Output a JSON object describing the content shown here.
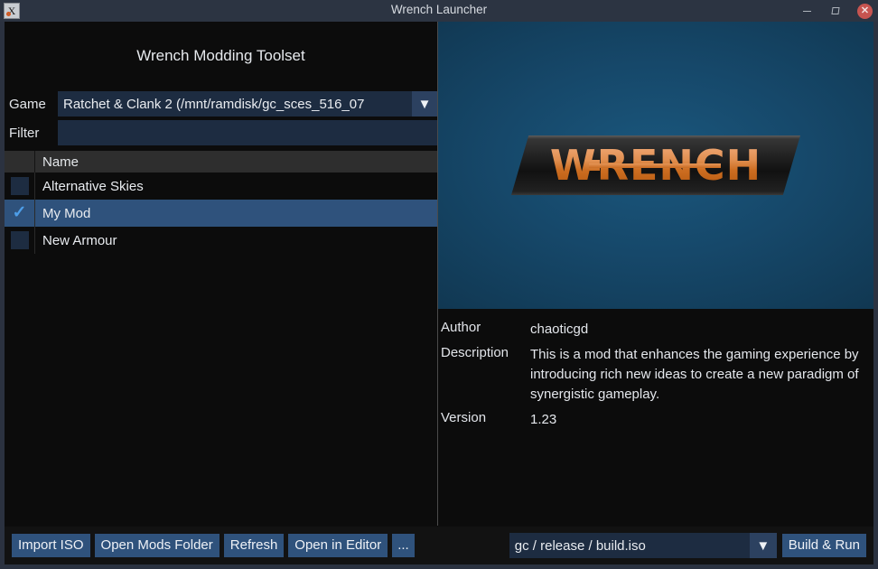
{
  "window": {
    "title": "Wrench Launcher",
    "icon": "app-icon",
    "controls": {
      "minimize": "–",
      "maximize": "□",
      "close": "✕"
    }
  },
  "left": {
    "heading": "Wrench Modding Toolset",
    "game": {
      "label": "Game",
      "value": "Ratchet & Clank 2 (/mnt/ramdisk/gc_sces_516_07",
      "arrow": "▼"
    },
    "filter": {
      "label": "Filter",
      "value": "",
      "placeholder": ""
    },
    "table": {
      "columns": [
        "",
        "Name"
      ],
      "rows": [
        {
          "checked": false,
          "name": "Alternative Skies",
          "selected": false
        },
        {
          "checked": true,
          "name": "My Mod",
          "selected": true
        },
        {
          "checked": false,
          "name": "New Armour",
          "selected": false
        }
      ],
      "check_glyph": "✓"
    }
  },
  "right": {
    "banner": {
      "logo_text": "WRENCH"
    },
    "info": {
      "author_label": "Author",
      "author_value": "chaoticgd",
      "description_label": "Description",
      "description_value": "This is a mod that enhances the gaming experience by introducing rich new ideas to create a new paradigm of synergistic gameplay.",
      "version_label": "Version",
      "version_value": "1.23"
    }
  },
  "bottom": {
    "buttons": [
      "Import ISO",
      "Open Mods Folder",
      "Refresh",
      "Open in Editor",
      "..."
    ],
    "build_select": {
      "value": "gc / release / build.iso",
      "arrow": "▼"
    },
    "build_run": "Build & Run"
  },
  "colors": {
    "titlebar": "#2c3442",
    "panel_bg": "#0c0c0c",
    "accent_blue": "#2f527c",
    "field_blue": "#1d2c41",
    "banner_center": "#1a577d",
    "logo_orange": "#cc6d21",
    "close_red": "#c75450"
  }
}
